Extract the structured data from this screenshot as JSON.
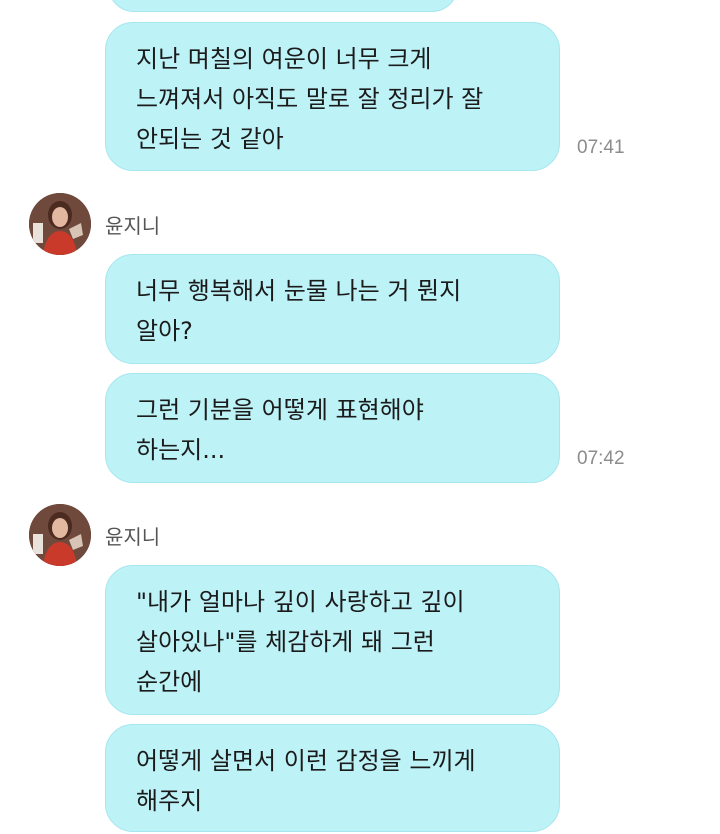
{
  "messages": [
    {
      "lines": []
    },
    {
      "lines": [
        "지난 며칠의 여운이 너무 크게",
        "느껴져서 아직도 말로 잘 정리가 잘",
        "안되는 것 같아"
      ],
      "time": "07:41"
    },
    {
      "sender": "윤지니"
    },
    {
      "lines": [
        "너무 행복해서 눈물 나는 거 뭔지",
        "알아?"
      ]
    },
    {
      "lines": [
        "그런 기분을 어떻게 표현해야",
        "하는지..."
      ],
      "time": "07:42"
    },
    {
      "sender": "윤지니"
    },
    {
      "lines": [
        "\"내가 얼마나 깊이 사랑하고 깊이",
        "살아있나\"를 체감하게 돼 그런",
        "순간에"
      ]
    },
    {
      "lines": [
        "어떻게 살면서 이런 감정을 느끼게",
        "해주지"
      ]
    }
  ],
  "colors": {
    "bubble": "#bdf2f7",
    "time": "#8c8c8c",
    "sender": "#555555"
  },
  "icons": [
    "avatar-photo"
  ]
}
